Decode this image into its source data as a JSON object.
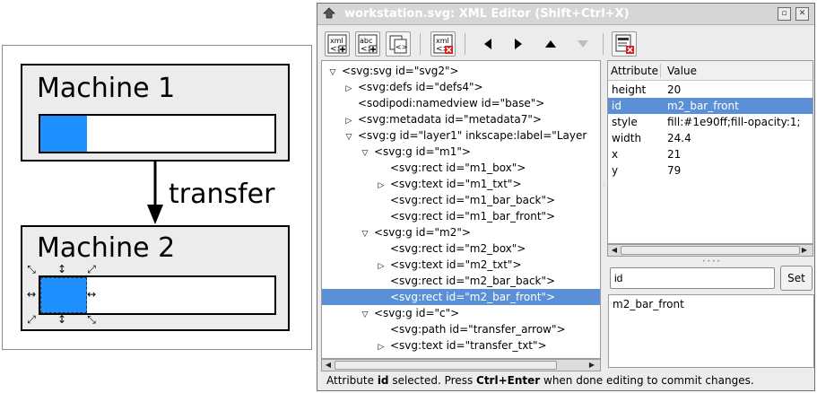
{
  "canvas": {
    "machine1": {
      "label": "Machine 1",
      "progress": 0.2
    },
    "machine2": {
      "label": "Machine 2",
      "progress": 0.2
    },
    "transfer_label": "transfer",
    "colors": {
      "bar_front": "#1e90ff",
      "box_fill": "#ececec"
    }
  },
  "window": {
    "title": "workstation.svg: XML Editor (Shift+Ctrl+X)",
    "title_icon": "inkscape-icon",
    "title_buttons": [
      "restore-icon",
      "close-icon"
    ]
  },
  "toolbar": {
    "buttons": [
      {
        "name": "new-element-node-button",
        "icon": "xml-new-element-icon",
        "text": "xml"
      },
      {
        "name": "new-text-node-button",
        "icon": "xml-new-text-icon",
        "text": "abc"
      },
      {
        "name": "duplicate-node-button",
        "icon": "duplicate-node-icon",
        "text": ""
      },
      {
        "name": "delete-node-button",
        "icon": "xml-delete-node-icon",
        "text": "xml"
      },
      {
        "name": "unindent-node-button",
        "icon": "arrow-left-icon",
        "text": ""
      },
      {
        "name": "indent-node-button",
        "icon": "arrow-right-icon",
        "text": ""
      },
      {
        "name": "raise-node-button",
        "icon": "arrow-up-icon",
        "text": ""
      },
      {
        "name": "lower-node-button",
        "icon": "arrow-down-icon",
        "text": ""
      },
      {
        "name": "delete-attribute-button",
        "icon": "delete-attribute-icon",
        "text": ""
      }
    ]
  },
  "tree": {
    "nodes": [
      {
        "text": "<svg:svg id=\"svg2\">",
        "depth": 0,
        "expander": "open"
      },
      {
        "text": "<svg:defs id=\"defs4\">",
        "depth": 1,
        "expander": "closed"
      },
      {
        "text": "<sodipodi:namedview id=\"base\">",
        "depth": 1,
        "expander": "none"
      },
      {
        "text": "<svg:metadata id=\"metadata7\">",
        "depth": 1,
        "expander": "closed"
      },
      {
        "text": "<svg:g id=\"layer1\" inkscape:label=\"Layer",
        "depth": 1,
        "expander": "open"
      },
      {
        "text": "<svg:g id=\"m1\">",
        "depth": 2,
        "expander": "open"
      },
      {
        "text": "<svg:rect id=\"m1_box\">",
        "depth": 3,
        "expander": "none"
      },
      {
        "text": "<svg:text id=\"m1_txt\">",
        "depth": 3,
        "expander": "closed"
      },
      {
        "text": "<svg:rect id=\"m1_bar_back\">",
        "depth": 3,
        "expander": "none"
      },
      {
        "text": "<svg:rect id=\"m1_bar_front\">",
        "depth": 3,
        "expander": "none"
      },
      {
        "text": "<svg:g id=\"m2\">",
        "depth": 2,
        "expander": "open"
      },
      {
        "text": "<svg:rect id=\"m2_box\">",
        "depth": 3,
        "expander": "none"
      },
      {
        "text": "<svg:text id=\"m2_txt\">",
        "depth": 3,
        "expander": "closed"
      },
      {
        "text": "<svg:rect id=\"m2_bar_back\">",
        "depth": 3,
        "expander": "none"
      },
      {
        "text": "<svg:rect id=\"m2_bar_front\">",
        "depth": 3,
        "expander": "none",
        "selected": true
      },
      {
        "text": "<svg:g id=\"c\">",
        "depth": 2,
        "expander": "open"
      },
      {
        "text": "<svg:path id=\"transfer_arrow\">",
        "depth": 3,
        "expander": "none"
      },
      {
        "text": "<svg:text id=\"transfer_txt\">",
        "depth": 3,
        "expander": "closed"
      }
    ]
  },
  "attributes": {
    "col_name": "Attribute",
    "col_value": "Value",
    "rows": [
      {
        "name": "height",
        "value": "20"
      },
      {
        "name": "id",
        "value": "m2_bar_front",
        "selected": true
      },
      {
        "name": "style",
        "value": "fill:#1e90ff;fill-opacity:1;"
      },
      {
        "name": "width",
        "value": "24.4"
      },
      {
        "name": "x",
        "value": "21"
      },
      {
        "name": "y",
        "value": "79"
      }
    ]
  },
  "editor": {
    "attr_name": "id",
    "set_label": "Set",
    "attr_value": "m2_bar_front"
  },
  "status": {
    "pre": "Attribute ",
    "attr": "id",
    "mid": " selected. Press ",
    "key": "Ctrl+Enter",
    "post": " when done editing to commit changes."
  }
}
